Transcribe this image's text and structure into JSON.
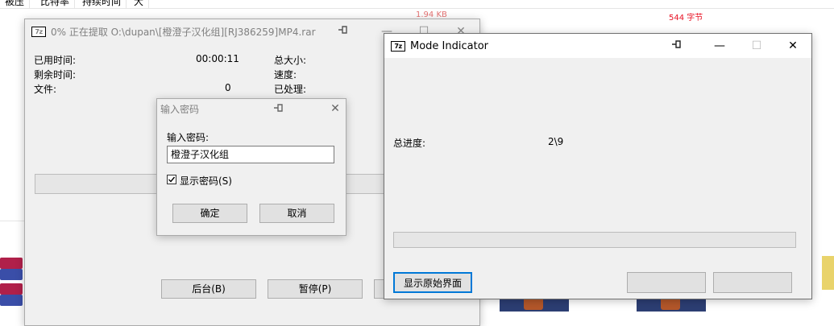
{
  "background": {
    "columns": [
      "被压",
      "比特率",
      "持续时间",
      "大"
    ],
    "size_text": "1.94 KB",
    "bytes_text": "544 字节"
  },
  "extract_window": {
    "icon_text": "7z",
    "title": "0% 正在提取 O:\\dupan\\[橙澄子汉化组][RJ386259]MP4.rar",
    "pin_icon": "pin-icon",
    "minimize_glyph": "—",
    "maximize_glyph": "☐",
    "close_glyph": "✕",
    "elapsed_label": "已用时间:",
    "elapsed_value": "00:00:11",
    "remaining_label": "剩余时间:",
    "files_label": "文件:",
    "files_value": "0",
    "total_size_label": "总大小:",
    "speed_label": "速度:",
    "processed_label": "已处理:",
    "background_button": "后台(B)",
    "pause_button": "暂停(P)",
    "progress": 0
  },
  "password_dialog": {
    "title": "输入密码",
    "pin_icon": "pin-icon",
    "close_glyph": "✕",
    "prompt_label": "输入密码:",
    "password_value": "橙澄子汉化组",
    "show_password_label": "显示密码(S)",
    "show_password_checked": true,
    "ok_button": "确定",
    "cancel_button": "取消"
  },
  "mode_window": {
    "icon_text": "7z",
    "title": "Mode Indicator",
    "pin_icon": "pin-icon",
    "minimize_glyph": "—",
    "maximize_glyph": "☐",
    "close_glyph": "✕",
    "total_progress_label": "总进度:",
    "total_progress_value": "2\\9",
    "progress": 0,
    "show_original_button": "显示原始界面"
  }
}
